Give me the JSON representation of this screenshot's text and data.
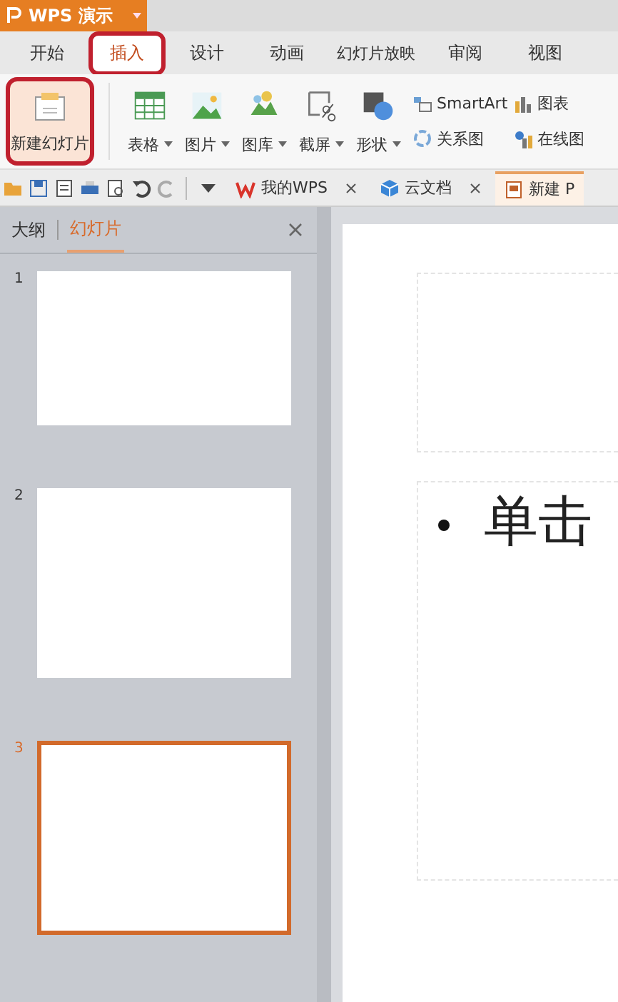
{
  "app": {
    "title": "WPS 演示"
  },
  "ribbon_tabs": [
    {
      "label": "开始",
      "selected": false,
      "circled": false
    },
    {
      "label": "插入",
      "selected": true,
      "circled": true
    },
    {
      "label": "设计",
      "selected": false,
      "circled": false
    },
    {
      "label": "动画",
      "selected": false,
      "circled": false
    },
    {
      "label": "幻灯片放映",
      "selected": false,
      "circled": false
    },
    {
      "label": "审阅",
      "selected": false,
      "circled": false
    },
    {
      "label": "视图",
      "selected": false,
      "circled": false
    }
  ],
  "new_slide": {
    "label": "新建幻灯片",
    "circled": true
  },
  "large_tools": [
    {
      "label": "表格",
      "dropdown": true
    },
    {
      "label": "图片",
      "dropdown": true
    },
    {
      "label": "图库",
      "dropdown": true
    },
    {
      "label": "截屏",
      "dropdown": true
    },
    {
      "label": "形状",
      "dropdown": true
    }
  ],
  "small_tools": [
    {
      "label": "SmartArt"
    },
    {
      "label": "关系图"
    }
  ],
  "small_tools_2": [
    {
      "label": "图表"
    },
    {
      "label": "在线图"
    }
  ],
  "doc_tabs": [
    {
      "label": "我的WPS",
      "closable": true,
      "selected": false
    },
    {
      "label": "云文档",
      "closable": true,
      "selected": false
    },
    {
      "label": "新建 P",
      "closable": false,
      "selected": true
    }
  ],
  "panel": {
    "tabs": [
      {
        "label": "大纲",
        "selected": false
      },
      {
        "label": "幻灯片",
        "selected": true
      }
    ],
    "slides": [
      {
        "number": "1",
        "selected": false
      },
      {
        "number": "2",
        "selected": false
      },
      {
        "number": "3",
        "selected": true
      }
    ]
  },
  "slide": {
    "bullet": "单击"
  }
}
